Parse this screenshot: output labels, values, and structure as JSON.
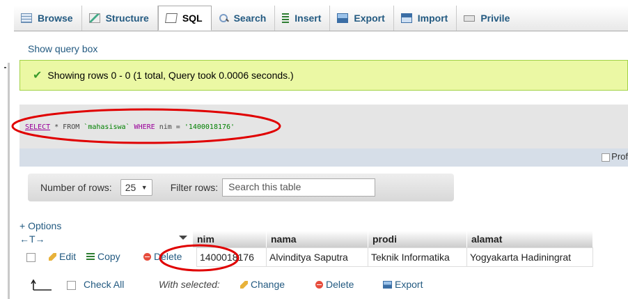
{
  "tabs": [
    {
      "label": "Browse",
      "icon": "browse-icon"
    },
    {
      "label": "Structure",
      "icon": "structure-icon"
    },
    {
      "label": "SQL",
      "icon": "sql-icon",
      "active": true
    },
    {
      "label": "Search",
      "icon": "search-icon"
    },
    {
      "label": "Insert",
      "icon": "insert-icon"
    },
    {
      "label": "Export",
      "icon": "export-icon"
    },
    {
      "label": "Import",
      "icon": "import-icon"
    },
    {
      "label": "Privile",
      "icon": "privileges-icon"
    }
  ],
  "show_query_box": "Show query box",
  "success_message": "Showing rows 0 - 0 (1 total, Query took 0.0006 seconds.)",
  "sql": {
    "select": "SELECT",
    "star_from": " * FROM ",
    "table": "`mahasiswa`",
    "where": " WHERE ",
    "condition": "nim = ",
    "value": "'1400018176'"
  },
  "profiling_label": "Prof",
  "navigation": {
    "rows_label": "Number of rows:",
    "rows_value": "25",
    "filter_label": "Filter rows:",
    "filter_placeholder": "Search this table"
  },
  "options_link": "+ Options",
  "column_arrows": "←T→",
  "columns": [
    "nim",
    "nama",
    "prodi",
    "alamat"
  ],
  "row_actions": {
    "edit": "Edit",
    "copy": "Copy",
    "delete": "Delete"
  },
  "rows": [
    {
      "nim": "1400018176",
      "nama": "Alvinditya Saputra",
      "prodi": "Teknik Informatika",
      "alamat": "Yogyakarta Hadiningrat"
    }
  ],
  "bulk": {
    "check_all": "Check All",
    "with_selected": "With selected:",
    "change": "Change",
    "delete": "Delete",
    "export": "Export"
  },
  "colors": {
    "link": "#235a81",
    "success_bg": "#ebf8a4",
    "annotation": "#e00000"
  }
}
